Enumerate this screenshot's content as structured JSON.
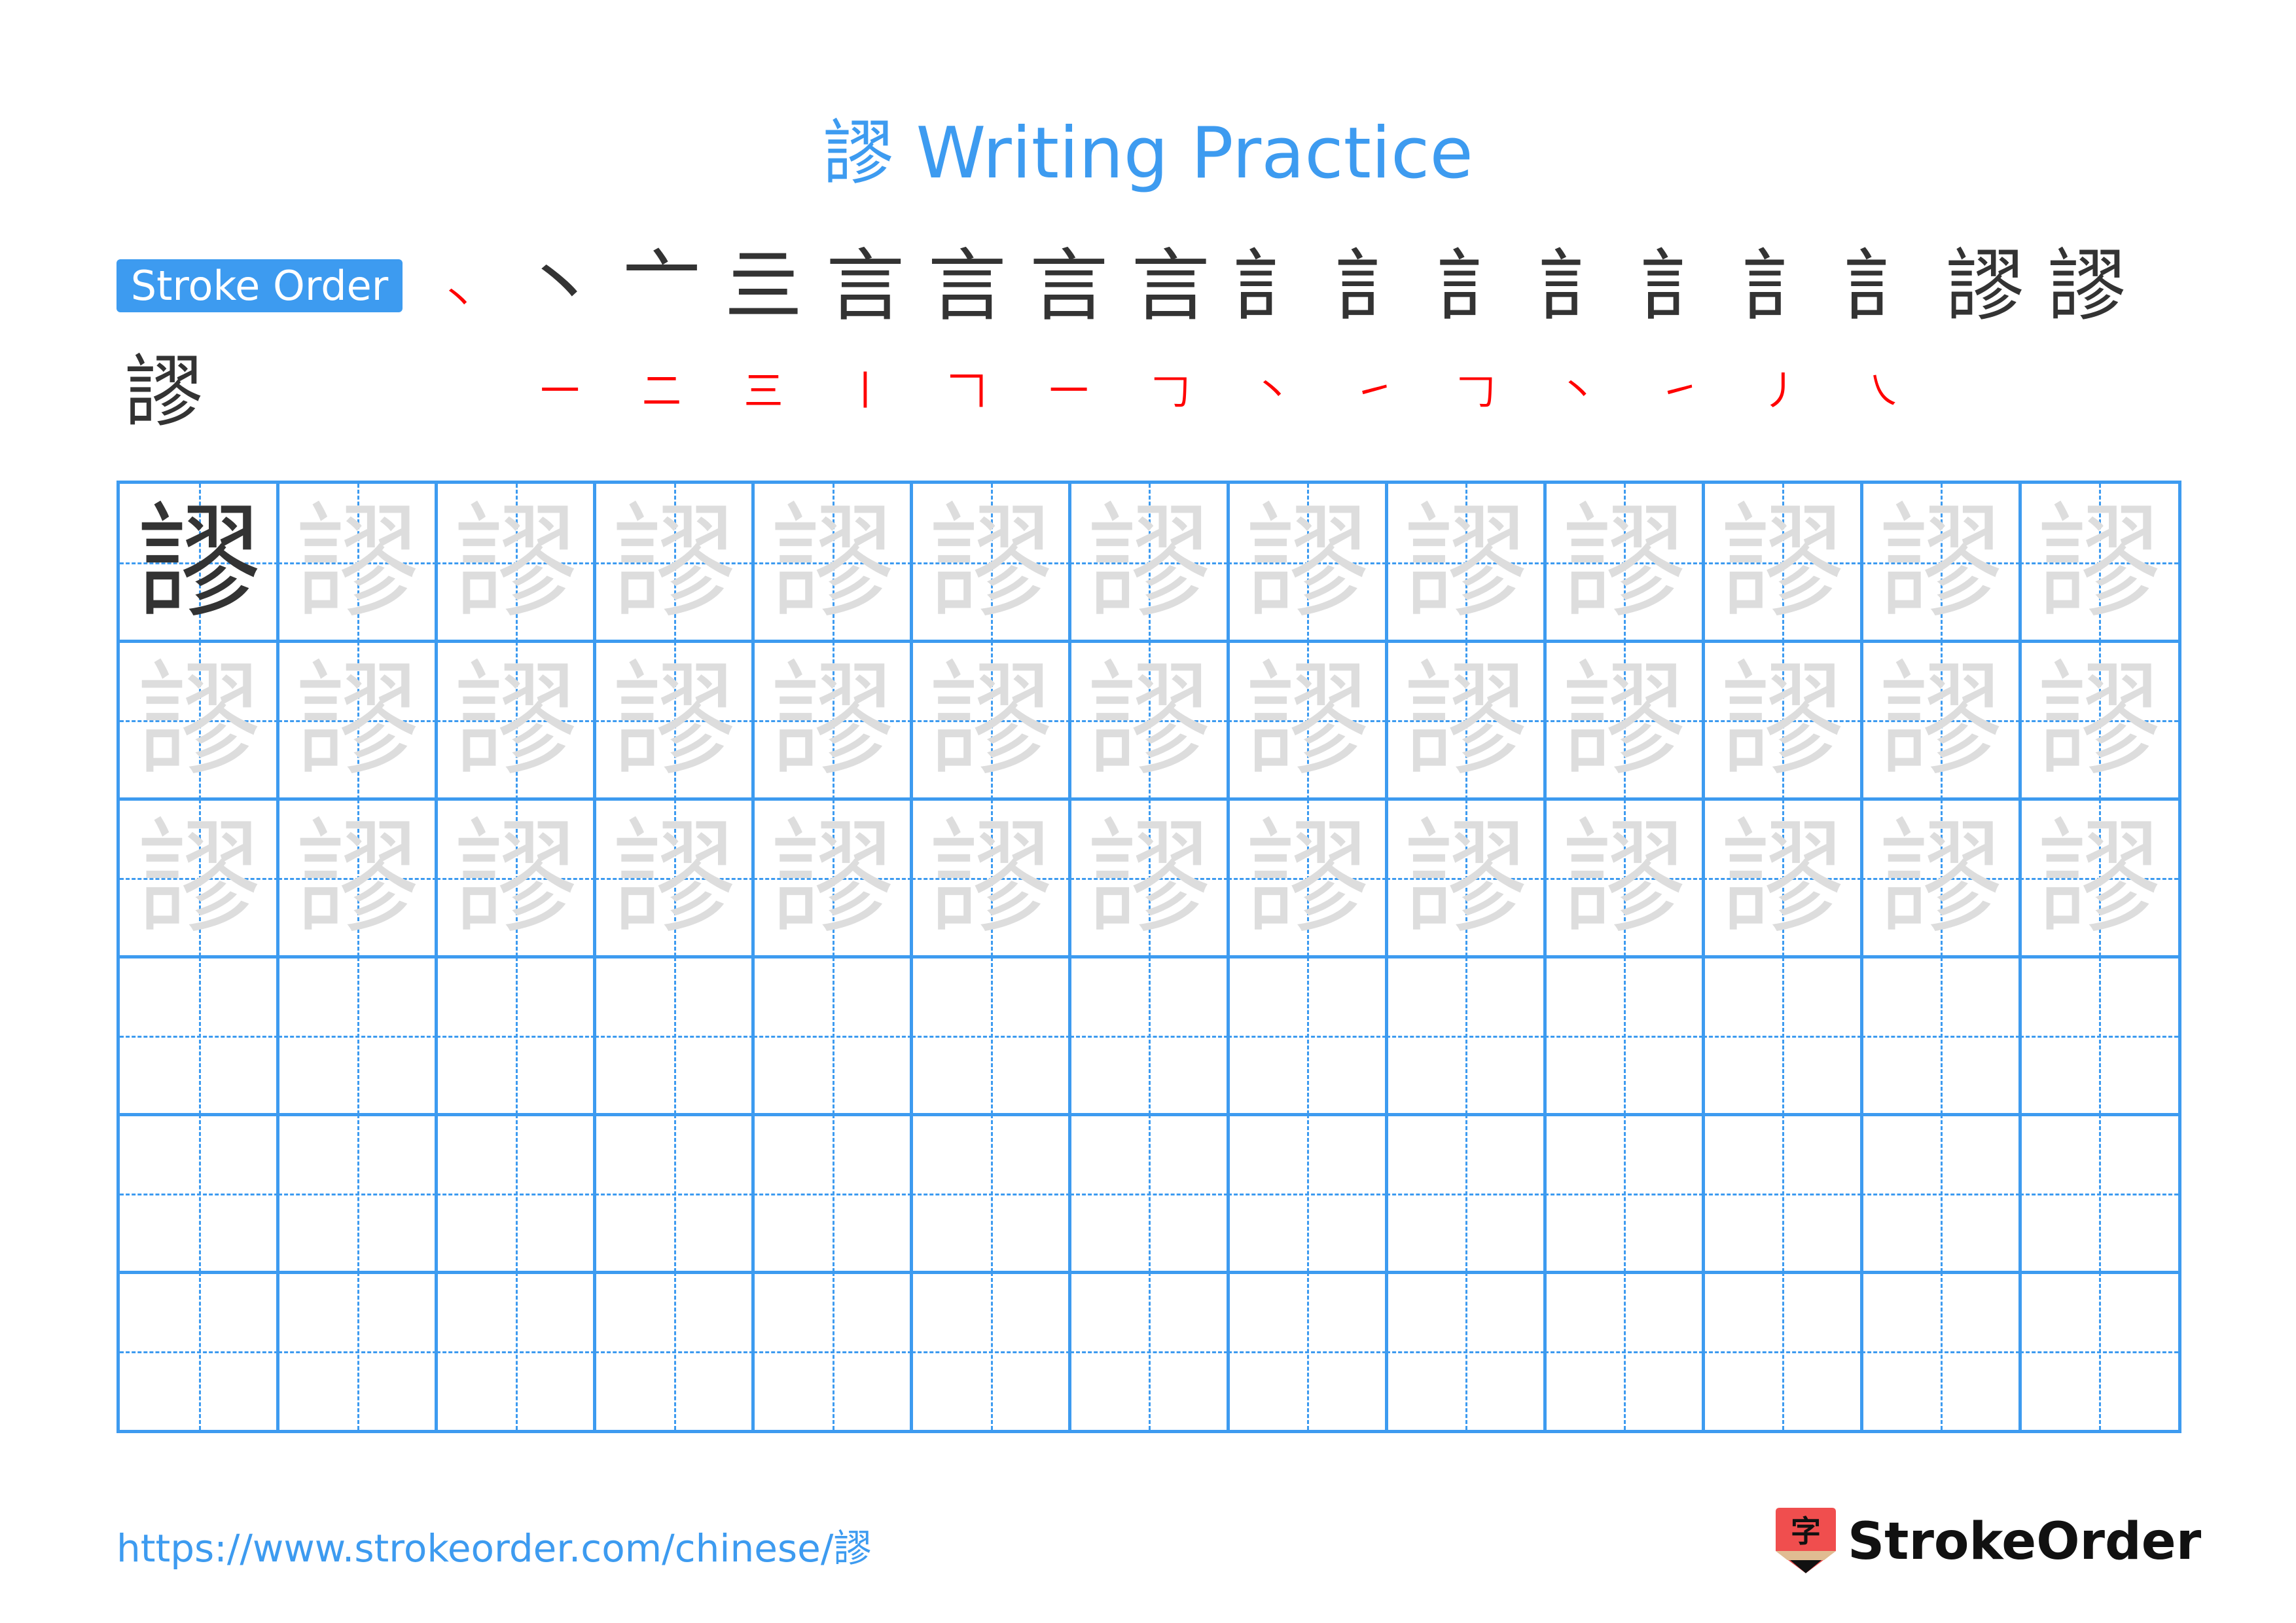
{
  "title": {
    "character": "謬",
    "text": "謬 Writing Practice"
  },
  "stroke_order": {
    "label": "Stroke Order",
    "total_strokes": 18,
    "steps": [
      {
        "step": 1,
        "done": "",
        "current": "丶"
      },
      {
        "step": 2,
        "done": "丶",
        "current": "一"
      },
      {
        "step": 3,
        "done": "亠",
        "current": "二"
      },
      {
        "step": 4,
        "done": "亖",
        "current": "三"
      },
      {
        "step": 5,
        "done": "言",
        "current": "丨"
      },
      {
        "step": 6,
        "done": "言",
        "current": "𠃍"
      },
      {
        "step": 7,
        "done": "言",
        "current": "一"
      },
      {
        "step": 8,
        "done": "言",
        "current": "𠃌"
      },
      {
        "step": 9,
        "done": "訁",
        "current": "丶"
      },
      {
        "step": 10,
        "done": "訁",
        "current": "㇀"
      },
      {
        "step": 11,
        "done": "訁",
        "current": "𠃌"
      },
      {
        "step": 12,
        "done": "訁",
        "current": "丶"
      },
      {
        "step": 13,
        "done": "訁",
        "current": "㇀"
      },
      {
        "step": 14,
        "done": "訁",
        "current": "丿"
      },
      {
        "step": 15,
        "done": "訁",
        "current": "㇏"
      },
      {
        "step": 16,
        "done": "謬",
        "current": "丿"
      },
      {
        "step": 17,
        "done": "謬",
        "current": "丿"
      },
      {
        "step": 18,
        "done": "謬",
        "current": "丿"
      }
    ]
  },
  "practice_grid": {
    "columns": 13,
    "rows": 6,
    "character": "謬",
    "row_types": [
      "model-then-trace",
      "trace",
      "trace",
      "empty",
      "empty",
      "empty"
    ]
  },
  "colors": {
    "accent": "#3d9bf0",
    "stroke_done": "#333333",
    "stroke_current": "#ff0000",
    "trace": "#dddddd",
    "logo_red": "#f04e4e",
    "logo_tan": "#e0bc92"
  },
  "footer": {
    "url": "https://www.strokeorder.com/chinese/謬",
    "logo_glyph": "字",
    "logo_text": "StrokeOrder"
  }
}
